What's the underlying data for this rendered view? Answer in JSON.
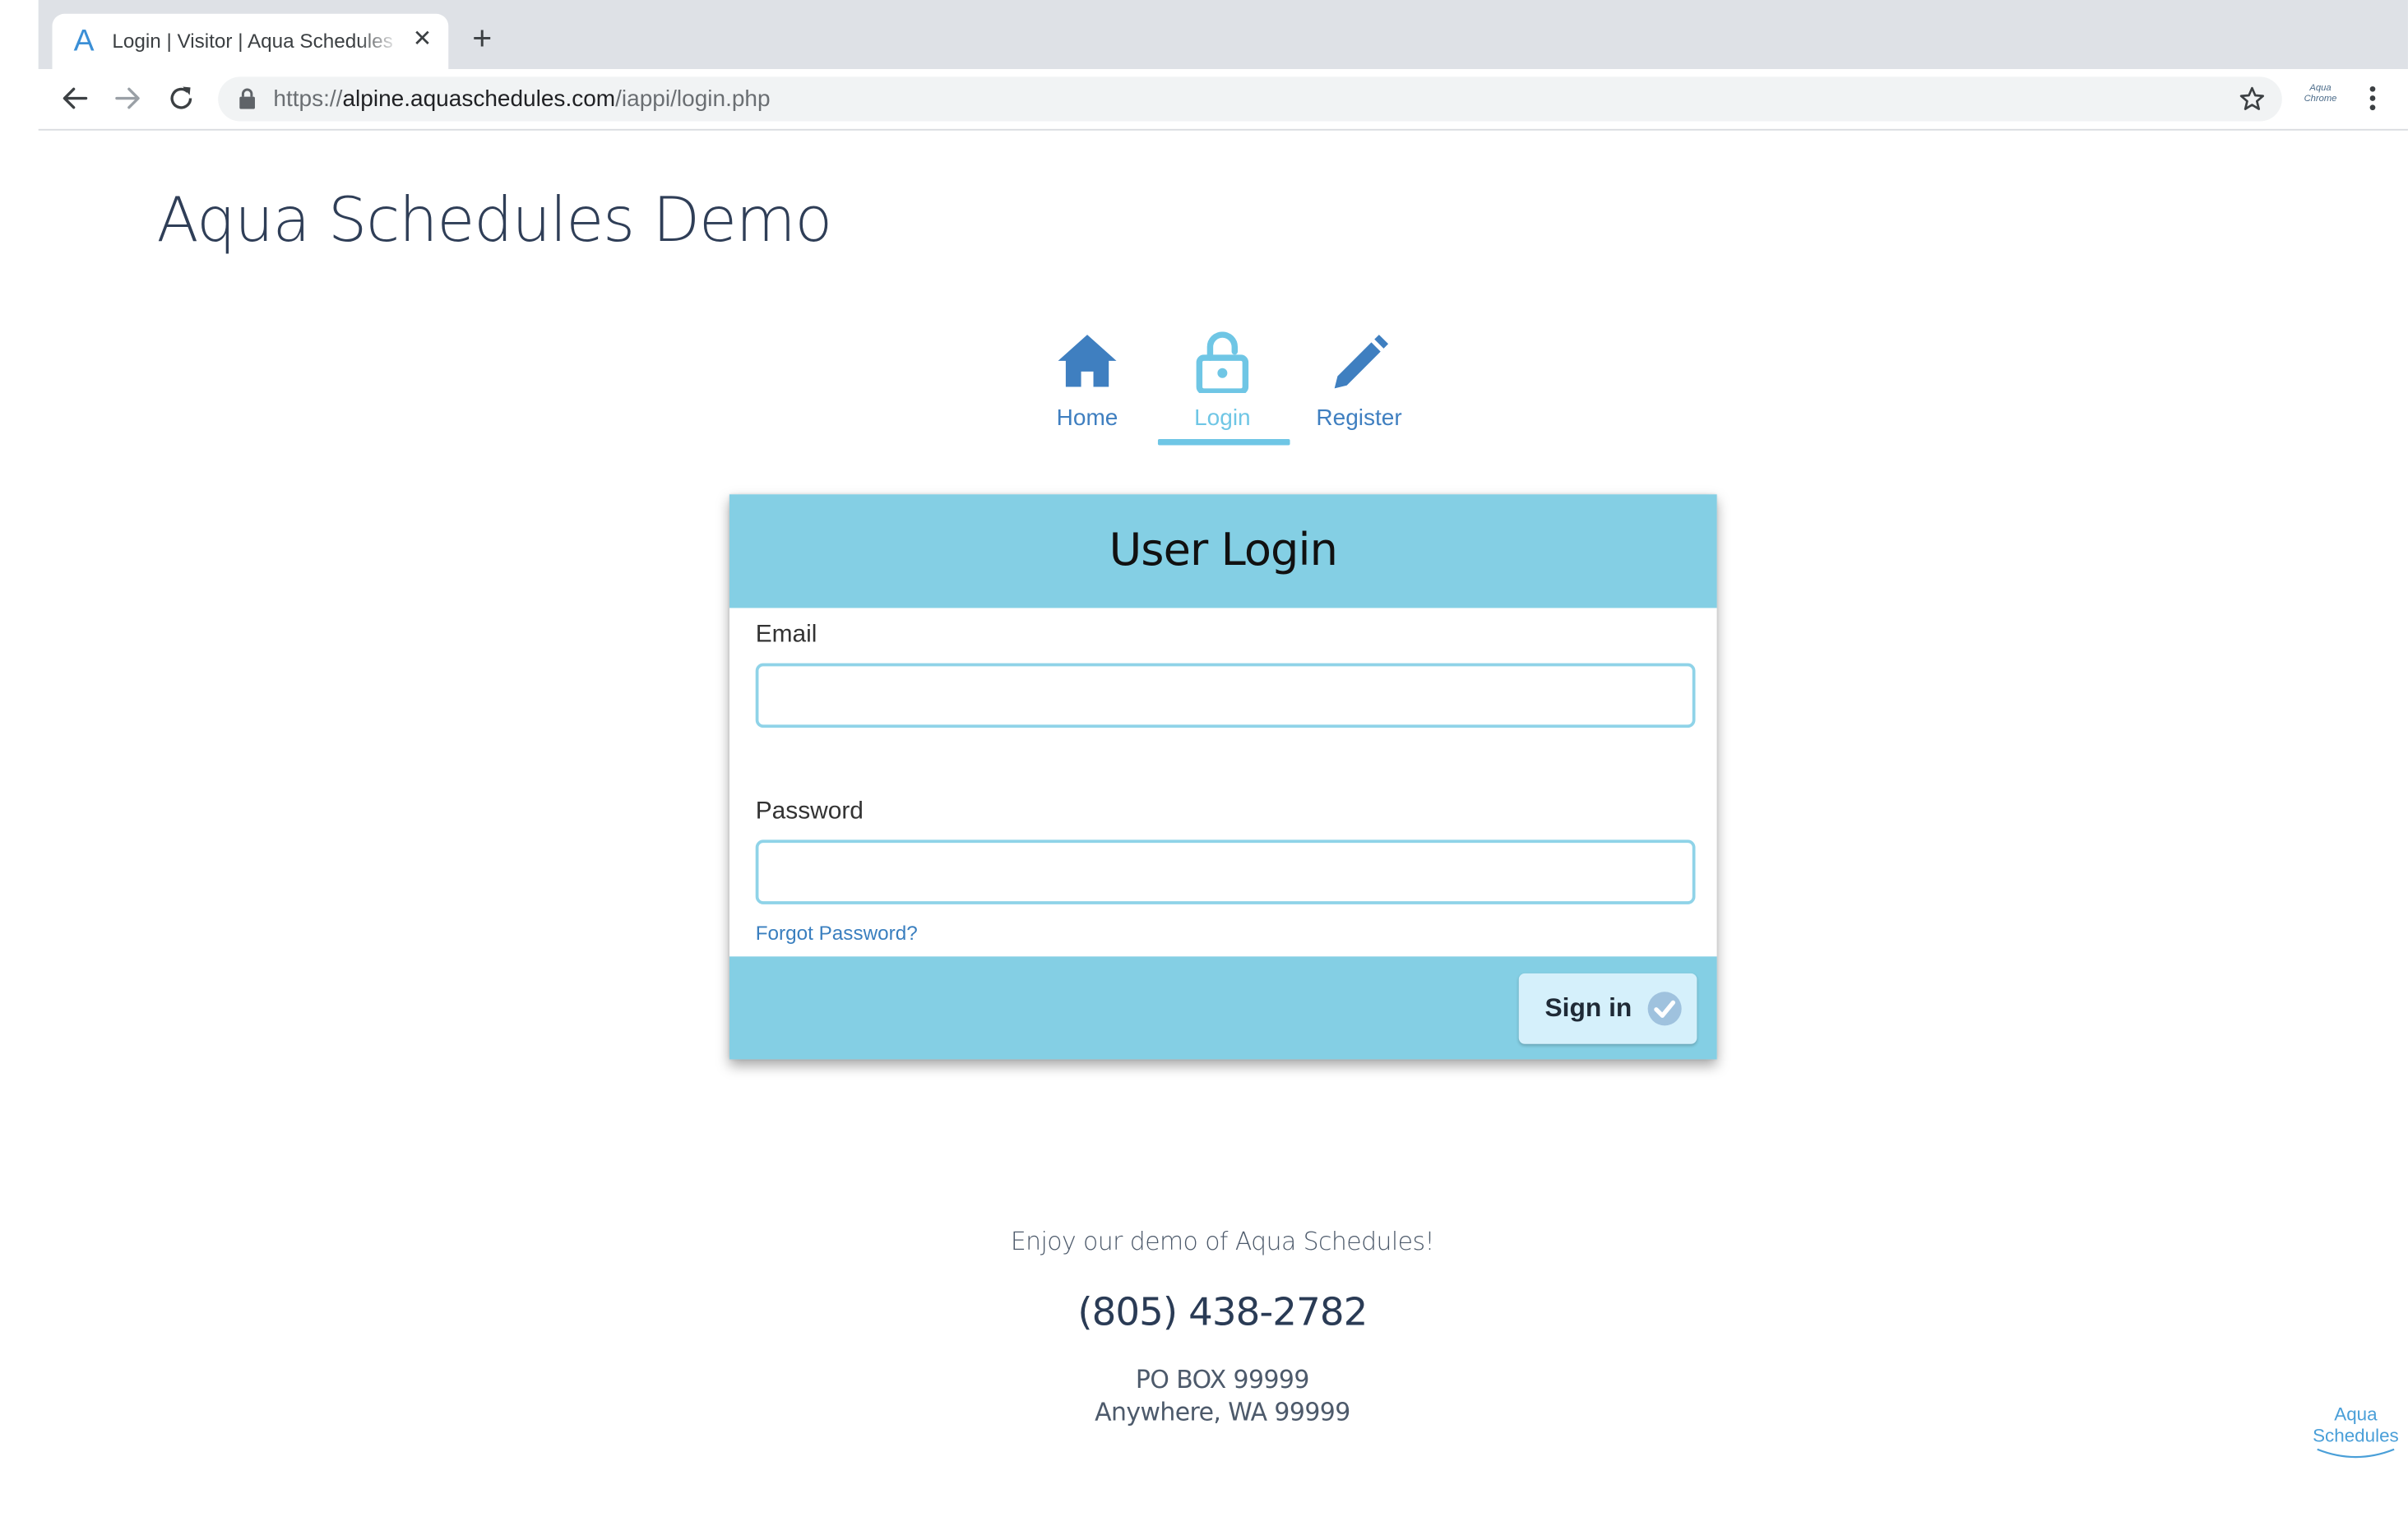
{
  "browser": {
    "tab_title": "Login | Visitor | Aqua Schedules",
    "tab_favicon": "A",
    "tab_close": "✕",
    "new_tab": "+",
    "url_scheme": "https://",
    "url_host": "alpine.aquaschedules.com",
    "url_path": "/iappi/login.php",
    "extension_label": "Aqua Chrome"
  },
  "page": {
    "site_title": "Aqua Schedules Demo"
  },
  "nav": {
    "items": [
      {
        "label": "Home",
        "icon": "home-icon",
        "active": false
      },
      {
        "label": "Login",
        "icon": "unlock-icon",
        "active": true
      },
      {
        "label": "Register",
        "icon": "pencil-icon",
        "active": false
      }
    ]
  },
  "login": {
    "title": "User Login",
    "email_label": "Email",
    "email_value": "",
    "password_label": "Password",
    "password_value": "",
    "forgot_label": "Forgot Password?",
    "signin_label": "Sign in"
  },
  "footer": {
    "tagline": "Enjoy our demo of Aqua Schedules!",
    "phone": "(805) 438-2782",
    "address_line1": "PO BOX 99999",
    "address_line2": "Anywhere, WA 99999",
    "logo_line1": "Aqua",
    "logo_line2": "Schedules"
  },
  "colors": {
    "accent": "#84cfe4",
    "nav_blue": "#3f7fc0",
    "nav_active": "#6fc6e5",
    "title_text": "#2f3e57"
  }
}
